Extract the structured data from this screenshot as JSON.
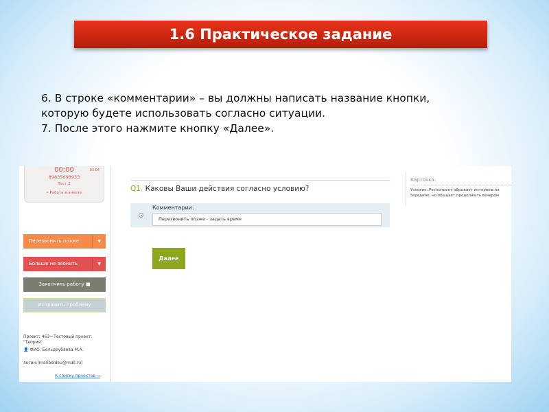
{
  "slide": {
    "title": "1.6 Практическое задание",
    "instructions": [
      "6. В строке «комментарии» – вы должны написать название кнопки,",
      "которую будете использовать согласно ситуации.",
      "7. После этого нажмите кнопку «Далее»."
    ]
  },
  "sidebar": {
    "timer": "00:00",
    "time_right": "03:04",
    "phone": "89835698933",
    "test": "Тест 2",
    "status": "• Работа в анкете",
    "buttons": {
      "call_later": "Перезвонить позже",
      "no_call": "Больше не звонить",
      "finish": "Закончить работу ■",
      "fix": "Исправить проблему"
    },
    "project": "Проект: 463—Тестовый проект: \"Теория\"",
    "fio": "ФИО: Бельдеубаева М.А.",
    "login": "логин:[maribeldeu@mail.ru]",
    "projects_link": "К списку проектов"
  },
  "main": {
    "q_num": "Q1.",
    "question": "Каковы Ваши действия согласно условию?",
    "comment_label": "Комментарии:",
    "comment_value": "Перезвонить позже - задать время",
    "next": "Далее"
  },
  "card": {
    "title": "Карточка:",
    "text": "Условие: Респондент обрывает интервью на середине, но обещает продолжить вечером"
  }
}
